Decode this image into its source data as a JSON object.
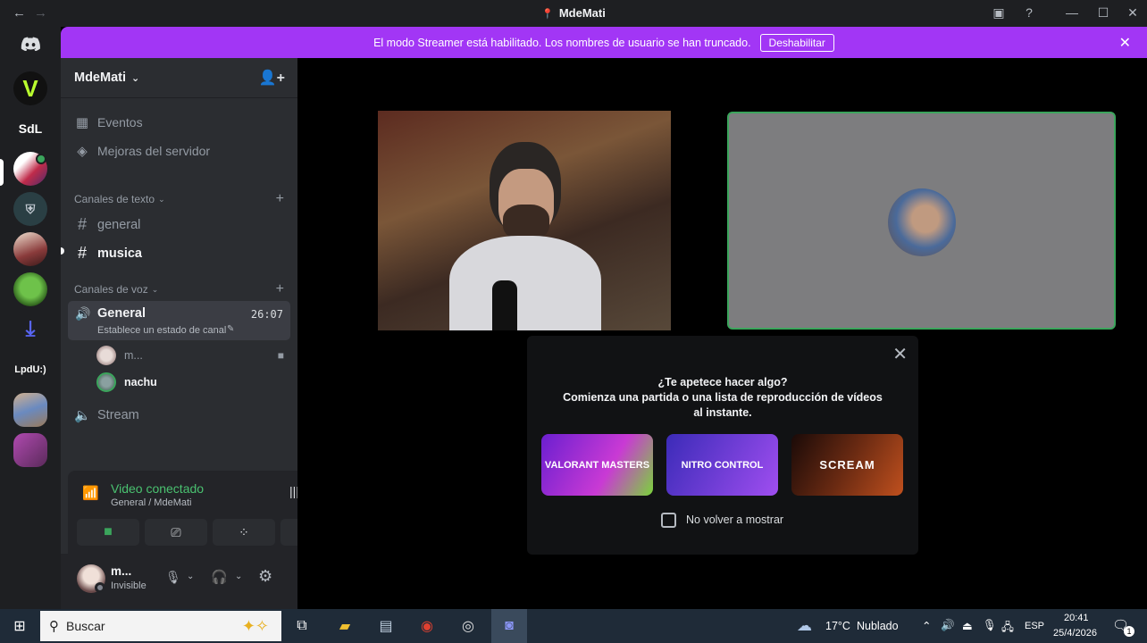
{
  "window": {
    "title": "MdeMati"
  },
  "banner": {
    "text": "El modo Streamer está habilitado. Los nombres de usuario se han truncado.",
    "button": "Deshabilitar"
  },
  "guilds": [
    {
      "label": "",
      "icon": "discord-logo-icon",
      "color": "#1e1f22"
    },
    {
      "label": "V",
      "icon": "server-v-icon",
      "color": "#1a1a1a"
    },
    {
      "label": "SdL",
      "icon": "server-sdl-icon",
      "color": "#1e1f22"
    },
    {
      "label": "",
      "icon": "server-bell-icon",
      "color": "#6b2b40"
    },
    {
      "label": "",
      "icon": "server-crest-icon",
      "color": "#2a3f44"
    },
    {
      "label": "",
      "icon": "server-anime-icon",
      "color": "#8a3b3b"
    },
    {
      "label": "",
      "icon": "server-frog-icon",
      "color": "#3a7a2a"
    },
    {
      "label": "",
      "icon": "download-icon",
      "color": "#1e1f22"
    },
    {
      "label": "LpdU:)",
      "icon": "server-lpdu-icon",
      "color": "#1e1f22"
    },
    {
      "label": "",
      "icon": "server-photo-icon",
      "color": "#9a7a5a"
    },
    {
      "label": "",
      "icon": "server-purple-icon",
      "color": "#8a3a8a"
    }
  ],
  "server": {
    "name": "MdeMati",
    "events": "Eventos",
    "boosts": "Mejoras del servidor",
    "text_category": "Canales de texto",
    "text_channels": [
      "general",
      "musica"
    ],
    "voice_category": "Canales de voz",
    "voice_channel": {
      "name": "General",
      "timer": "26:07",
      "status": "Establece un estado de canal",
      "users": [
        "m...",
        "nachu"
      ]
    },
    "stream_channel": "Stream"
  },
  "voice_panel": {
    "status": "Video conectado",
    "channel": "General / MdeMati"
  },
  "user": {
    "name": "m...",
    "status": "Invisible"
  },
  "popup": {
    "title": "¿Te apetece hacer algo?",
    "subtitle": "Comienza una partida o una lista de reproducción de vídeos al instante.",
    "activities": [
      {
        "label": "VALORANT MASTERS",
        "color1": "#6b1fd0",
        "color2": "#c93ad4"
      },
      {
        "label": "NITRO CONTROL",
        "color1": "#3b2bb8",
        "color2": "#a04ef0"
      },
      {
        "label": "SCREAM",
        "color1": "#3a1a12",
        "color2": "#c0501e"
      }
    ],
    "checkbox": "No volver a mostrar"
  },
  "taskbar": {
    "search": "Buscar",
    "weather_temp": "17°C",
    "weather_text": "Nublado",
    "lang": "ESP",
    "time": "20:41",
    "date": "25/4/2026",
    "notifications": "1"
  }
}
